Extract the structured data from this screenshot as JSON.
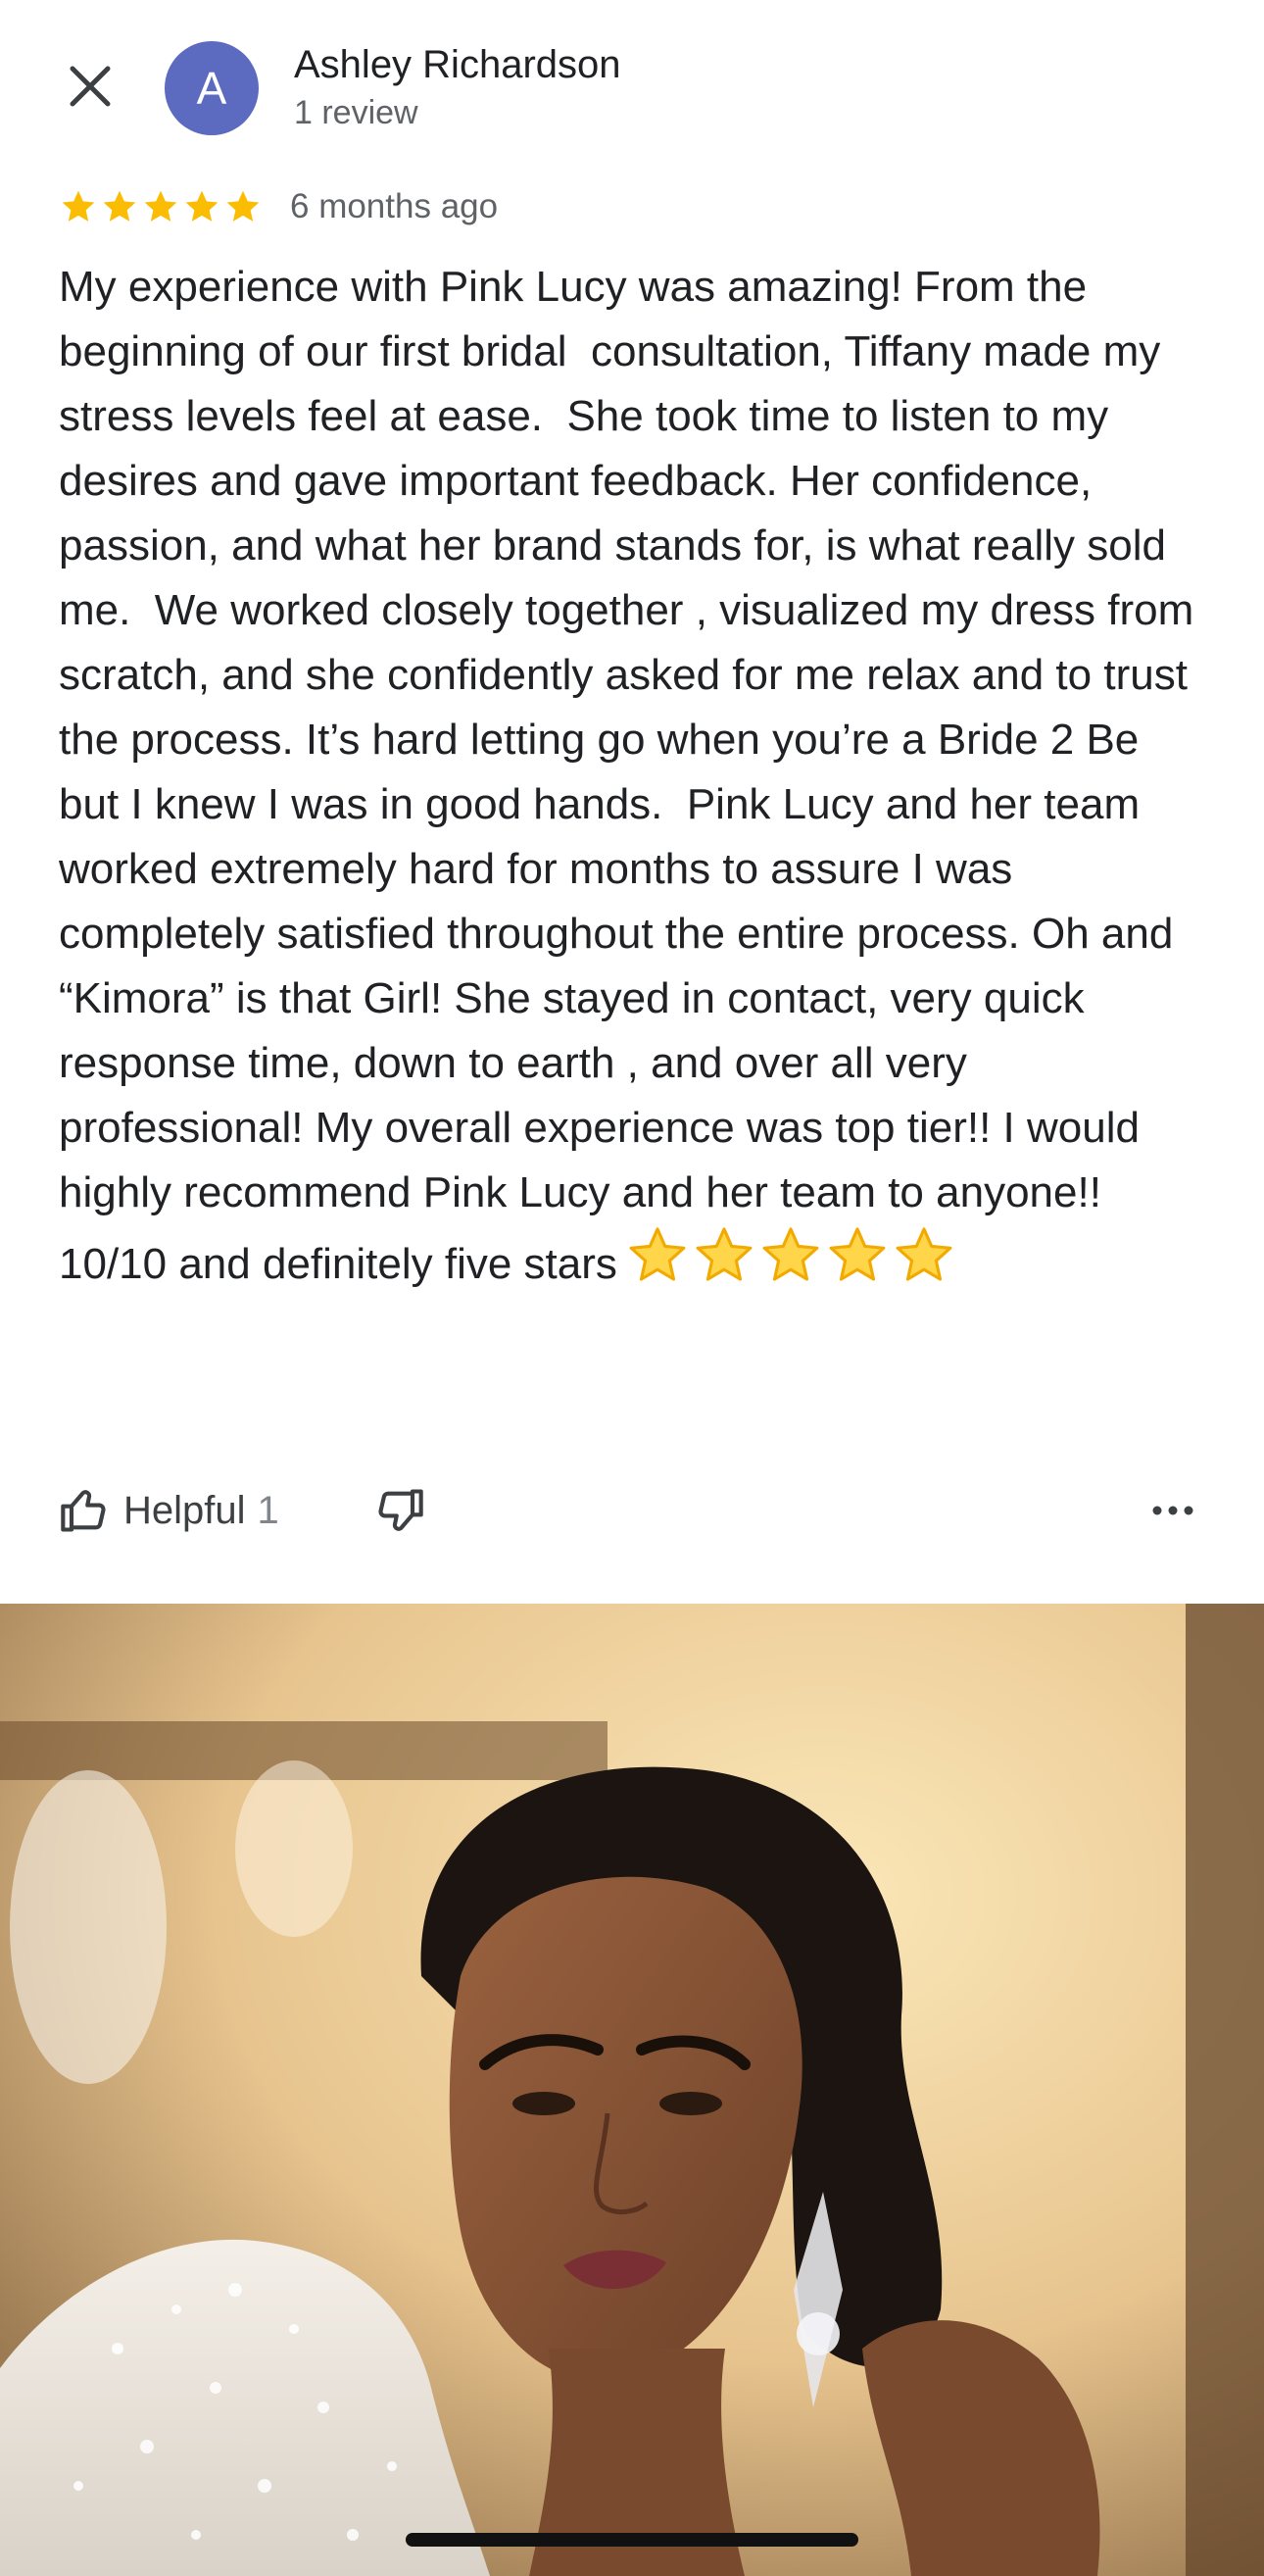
{
  "reviewer": {
    "avatar_letter": "A",
    "name": "Ashley Richardson",
    "review_count": "1 review"
  },
  "rating": {
    "stars": 5,
    "max_stars": 5,
    "time_ago": "6 months ago",
    "star_color": "#fbbc04"
  },
  "review": {
    "text": "My experience with Pink Lucy was amazing! From the beginning of our first bridal  consultation, Tiffany made my stress levels feel at ease.  She took time to listen to my desires and gave important feedback. Her confidence, passion, and what her brand stands for, is what really sold me.  We worked closely together , visualized my dress from scratch, and she confidently asked for me relax and to trust the process. It’s hard letting go when you’re a Bride 2 Be but I knew I was in good hands.  Pink Lucy and her team worked extremely hard for months to assure I was completely satisfied throughout the entire process. Oh and “Kimora” is that Girl! She stayed in contact, very quick response time, down to earth , and over all very professional! My overall experience was top tier!! I would highly recommend Pink Lucy and her team to anyone!! 10/10 and definitely five stars",
    "emoji": "⭐⭐⭐⭐⭐"
  },
  "actions": {
    "helpful_label": "Helpful",
    "helpful_count": "1"
  },
  "icons": {
    "close": "close-icon",
    "thumbs_up": "thumbs-up-icon",
    "thumbs_down": "thumbs-down-icon",
    "more": "more-horizontal-icon",
    "star": "star-icon"
  },
  "colors": {
    "avatar_bg": "#5c6bc0",
    "text_primary": "#202124",
    "text_secondary": "#5f6368"
  }
}
